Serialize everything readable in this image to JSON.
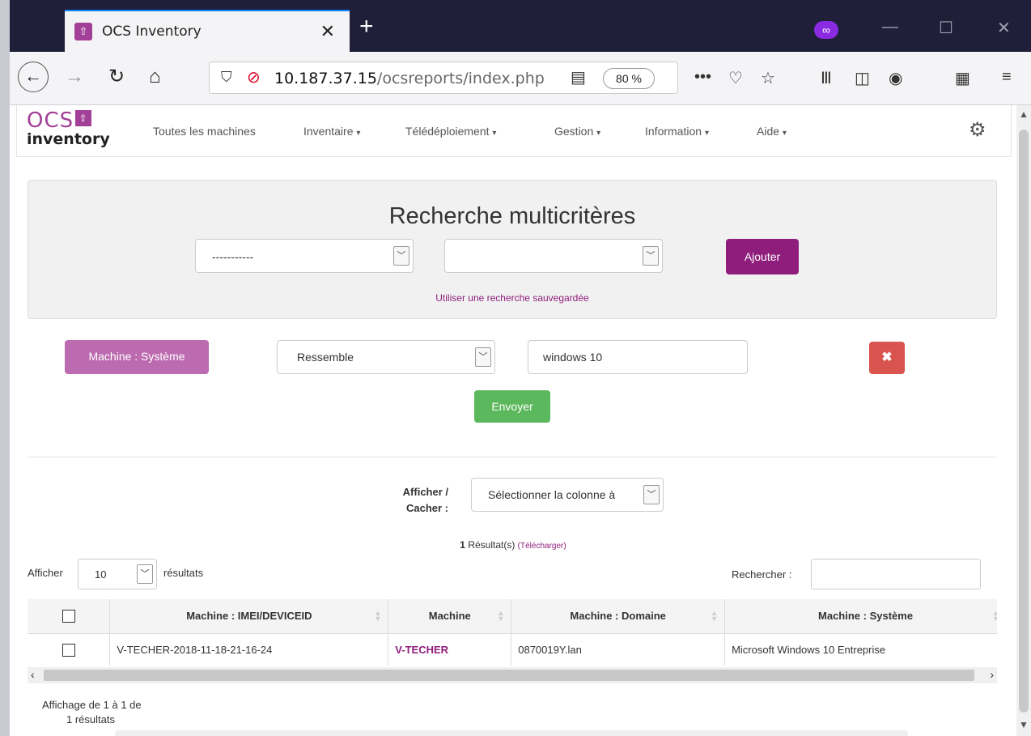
{
  "browser": {
    "tab_title": "OCS Inventory",
    "tab_close": "✕",
    "new_tab": "+",
    "url_host": "10.187.37.15",
    "url_path": "/ocsreports/index.php",
    "zoom": "80 %"
  },
  "app": {
    "logo_top": "OCS",
    "logo_bottom": "inventory",
    "menu": [
      {
        "label": "Toutes les machines",
        "dropdown": false
      },
      {
        "label": "Inventaire",
        "dropdown": true
      },
      {
        "label": "Télédéploiement",
        "dropdown": true
      },
      {
        "label": "Gestion",
        "dropdown": true
      },
      {
        "label": "Information",
        "dropdown": true
      },
      {
        "label": "Aide",
        "dropdown": true
      }
    ]
  },
  "search": {
    "title": "Recherche multicritères",
    "select1_value": "-----------",
    "select2_value": "",
    "add_button": "Ajouter",
    "saved_search_link": "Utiliser une recherche sauvegardée"
  },
  "criterion": {
    "field_label": "Machine : Système",
    "operator": "Ressemble",
    "value": "windows 10",
    "remove_label": "✖",
    "submit_label": "Envoyer"
  },
  "results": {
    "show_hide_label": "Afficher / Cacher :",
    "column_select": "Sélectionner la colonne à",
    "count": "1",
    "count_suffix": "Résultat(s)",
    "download_label": "(Télécharger)",
    "show_label": "Afficher",
    "page_length": "10",
    "results_label": "résultats",
    "search_label": "Rechercher :",
    "columns": [
      "Machine : IMEI/DEVICEID",
      "Machine",
      "Machine : Domaine",
      "Machine : Système"
    ],
    "rows": [
      {
        "imei": "V-TECHER-2018-11-18-21-16-24",
        "machine": "V-TECHER",
        "domain": "0870019Y.lan",
        "system": "Microsoft Windows 10 Entreprise"
      }
    ],
    "info_line1": "Affichage de 1 à 1 de",
    "info_line2": "1 résultats"
  }
}
